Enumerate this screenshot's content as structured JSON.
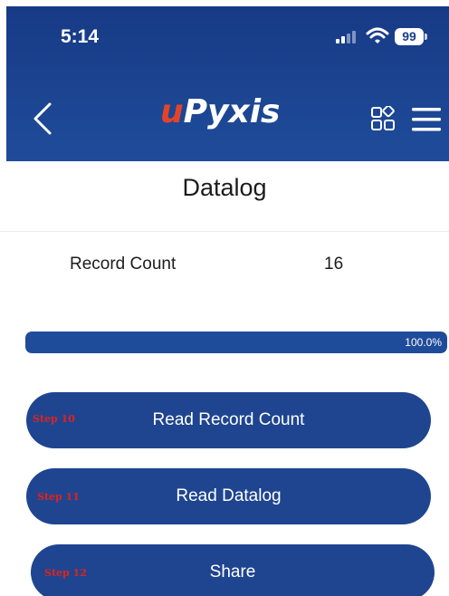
{
  "status_bar": {
    "time": "5:14",
    "battery": "99",
    "icons": [
      "signal-icon",
      "wifi-icon",
      "battery-icon"
    ]
  },
  "header": {
    "logo_u": "u",
    "logo_rest": "Pyxis",
    "icons": [
      "back-chevron-icon",
      "grid-icon",
      "menu-icon"
    ],
    "brand_color": "#1f4c9a",
    "logo_accent": "#e4432b"
  },
  "page": {
    "title": "Datalog"
  },
  "record": {
    "label": "Record Count",
    "value": "16"
  },
  "progress": {
    "percent": 100,
    "text": "100.0%"
  },
  "actions": [
    {
      "step": "Step 10",
      "label": "Read Record Count"
    },
    {
      "step": "Step 11",
      "label": "Read Datalog"
    },
    {
      "step": "Step 12",
      "label": "Share"
    }
  ],
  "colors": {
    "button": "#1f4590",
    "step_tag": "#e0231b"
  }
}
